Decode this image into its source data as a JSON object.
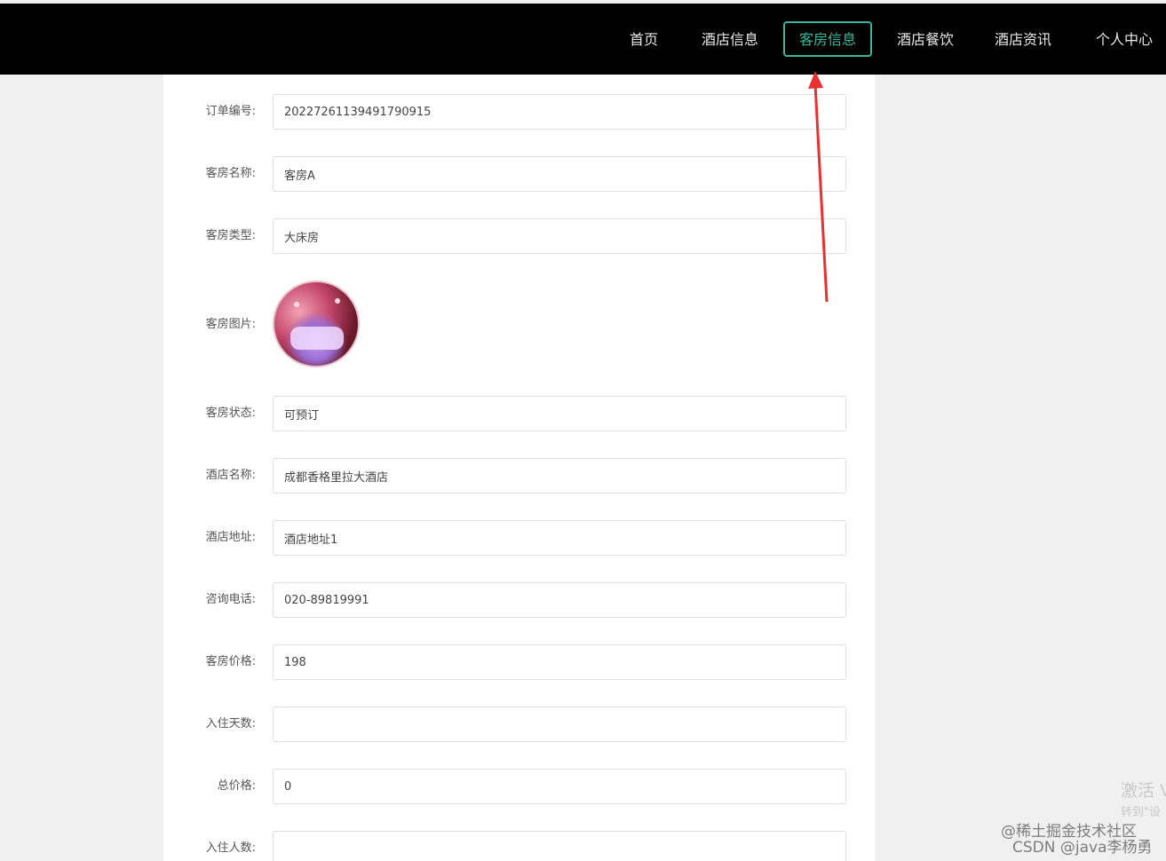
{
  "nav": {
    "items": [
      {
        "label": "首页",
        "active": false
      },
      {
        "label": "酒店信息",
        "active": false
      },
      {
        "label": "客房信息",
        "active": true
      },
      {
        "label": "酒店餐饮",
        "active": false
      },
      {
        "label": "酒店资讯",
        "active": false
      },
      {
        "label": "个人中心",
        "active": false
      }
    ],
    "active_color": "#3ab79c"
  },
  "form": {
    "order_no": {
      "label": "订单编号:",
      "value": "20227261139491790915"
    },
    "room_name": {
      "label": "客房名称:",
      "value": "客房A"
    },
    "room_type": {
      "label": "客房类型:",
      "value": "大床房"
    },
    "room_image": {
      "label": "客房图片:"
    },
    "room_status": {
      "label": "客房状态:",
      "value": "可预订"
    },
    "hotel_name": {
      "label": "酒店名称:",
      "value": "成都香格里拉大酒店"
    },
    "hotel_address": {
      "label": "酒店地址:",
      "value": "酒店地址1"
    },
    "phone": {
      "label": "咨询电话:",
      "value": "020-89819991"
    },
    "room_price": {
      "label": "客房价格:",
      "value": "198"
    },
    "stay_days": {
      "label": "入住天数:",
      "value": ""
    },
    "total_price": {
      "label": "总价格:",
      "value": "0"
    },
    "guest_count": {
      "label": "入住人数:",
      "value": ""
    }
  },
  "annotation": {
    "arrow_color": "#e8302f"
  },
  "watermarks": {
    "activate": "激活 V",
    "goto": "转到\"设",
    "juejin": "@稀土掘金技术社区",
    "csdn": "CSDN @java李杨勇"
  }
}
